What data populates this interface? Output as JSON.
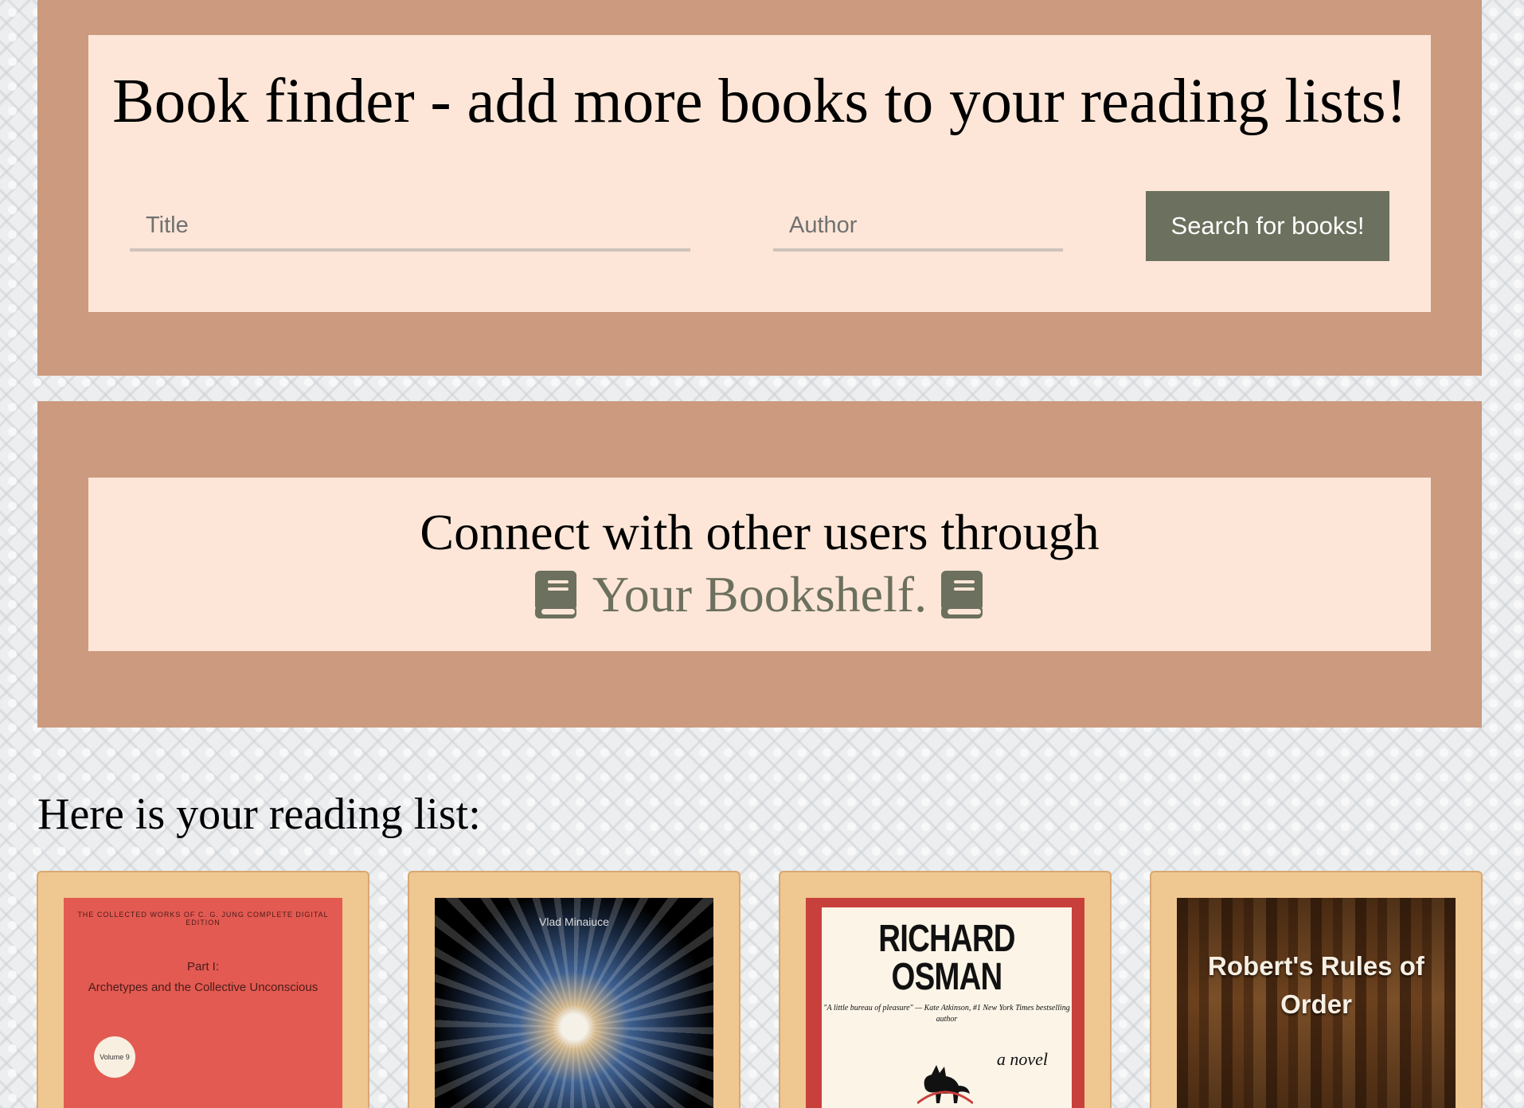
{
  "finder": {
    "title": "Book finder - add more books to your reading lists!",
    "title_placeholder": "Title",
    "author_placeholder": "Author",
    "search_label": "Search for books!"
  },
  "connect": {
    "line1": "Connect with other users through",
    "brand": "Your Bookshelf."
  },
  "reading_list": {
    "heading": "Here is your reading list:",
    "books": [
      {
        "cover_top": "THE COLLECTED WORKS OF C. G. JUNG  COMPLETE DIGITAL EDITION",
        "part": "Part I:",
        "subtitle": "Archetypes and the Collective Unconscious",
        "volume": "Volume 9"
      },
      {
        "author": "Vlad Minaiuce"
      },
      {
        "author": "RICHARD OSMAN",
        "quote": "\"A little bureau of pleasure\" — Kate Atkinson, #1 New York Times bestselling author",
        "tag": "a novel"
      },
      {
        "title": "Robert's Rules of Order"
      }
    ]
  },
  "colors": {
    "panel": "#cb9a7f",
    "panel_inner": "#fde6d7",
    "accent_green": "#6c705e",
    "card": "#efc790"
  },
  "icons": {
    "book": "book-icon"
  }
}
